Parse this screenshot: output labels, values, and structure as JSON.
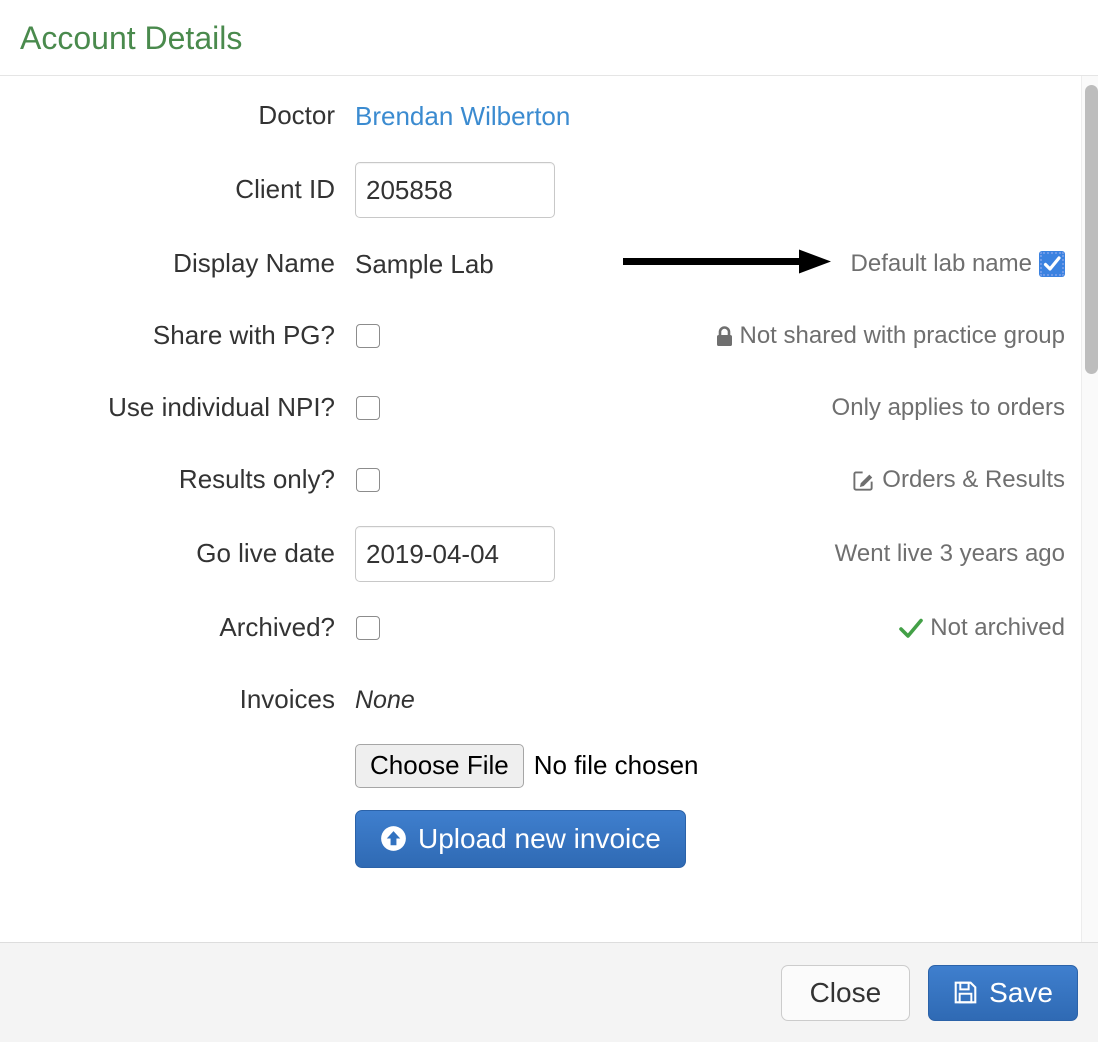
{
  "header": {
    "title": "Account Details",
    "title_color": "#4a8a4d"
  },
  "form": {
    "rows": [
      {
        "label": "Doctor",
        "type": "link",
        "value": "Brendan Wilberton",
        "help": ""
      },
      {
        "label": "Client ID",
        "type": "text-input",
        "value": "205858",
        "help": ""
      },
      {
        "label": "Display Name",
        "type": "static",
        "value": "Sample Lab",
        "help": "Default lab name",
        "help_icon": "checked-checkbox",
        "annotation": "arrow-right"
      },
      {
        "label": "Share with PG?",
        "type": "checkbox",
        "checked": false,
        "help": "Not shared with practice group",
        "help_icon": "lock-icon"
      },
      {
        "label": "Use individual NPI?",
        "type": "checkbox",
        "checked": false,
        "help": "Only applies to orders",
        "help_icon": ""
      },
      {
        "label": "Results only?",
        "type": "checkbox",
        "checked": false,
        "help": "Orders & Results",
        "help_icon": "edit-square-icon"
      },
      {
        "label": "Go live date",
        "type": "text-input",
        "value": "2019-04-04",
        "help": "Went live 3 years ago"
      },
      {
        "label": "Archived?",
        "type": "checkbox",
        "checked": false,
        "help": "Not archived",
        "help_icon": "check-icon"
      },
      {
        "label": "Invoices",
        "type": "italic-static",
        "value": "None",
        "help": ""
      }
    ],
    "file_picker": {
      "button_label": "Choose File",
      "status_text": "No file chosen"
    },
    "upload_button": {
      "label": "Upload new invoice",
      "icon": "arrow-circle-up-icon"
    }
  },
  "footer": {
    "close_label": "Close",
    "save_label": "Save",
    "save_icon": "floppy-disk-icon"
  },
  "colors": {
    "accent_green": "#4a8a4d",
    "link_blue": "#3b8bd0",
    "primary_blue": "#3272c0",
    "checked_blue": "#3b82e0",
    "success_green": "#43a047",
    "muted_text": "#6f6f6f",
    "footer_bg": "#f4f4f4"
  },
  "scrollbar": {
    "orientation": "vertical",
    "thumb_position": "top"
  }
}
